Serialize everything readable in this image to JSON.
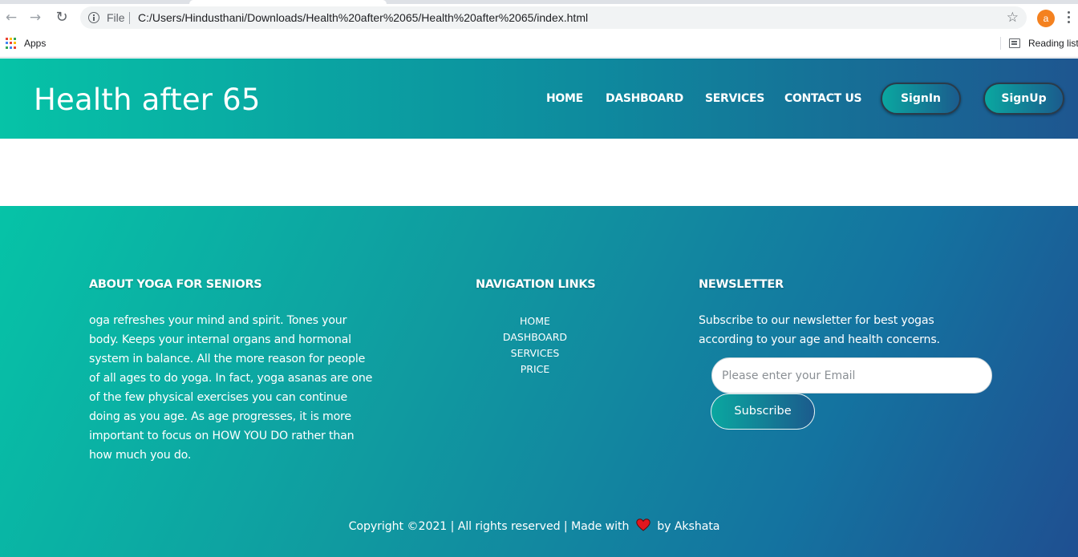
{
  "browser": {
    "scheme_label": "File",
    "url": "C:/Users/Hindusthani/Downloads/Health%20after%2065/Health%20after%2065/index.html",
    "profile_initial": "a",
    "profile_color": "#f4811f",
    "bookmarks": {
      "apps_label": "Apps",
      "reading_list_label": "Reading list"
    }
  },
  "header": {
    "logo": "Health after 65",
    "nav": [
      "HOME",
      "DASHBOARD",
      "SERVICES",
      "CONTACT US"
    ],
    "signin_label": "SignIn",
    "signup_label": "SignUp"
  },
  "footer": {
    "about": {
      "heading": "ABOUT YOGA FOR SENIORS",
      "text": "oga refreshes your mind and spirit. Tones your body. Keeps your internal organs and hormonal system in balance. All the more reason for people of all ages to do yoga. In fact, yoga asanas are one of the few physical exercises you can continue doing as you age. As age progresses, it is more important to focus on HOW YOU DO rather than how much you do."
    },
    "navigation": {
      "heading": "NAVIGATION LINKS",
      "links": [
        "HOME",
        "DASHBOARD",
        "SERVICES",
        "PRICE"
      ]
    },
    "newsletter": {
      "heading": "NEWSLETTER",
      "text": "Subscribe to our newsletter for best yogas according to your age and health concerns.",
      "email_placeholder": "Please enter your Email",
      "subscribe_label": "Subscribe"
    },
    "copyright_prefix": "Copyright ©2021 | All rights reserved | Made with",
    "copyright_suffix": "by Akshata"
  },
  "colors": {
    "gradient_start": "#06c3a7",
    "gradient_end": "#1f4f91",
    "heart": "#e3171e"
  }
}
